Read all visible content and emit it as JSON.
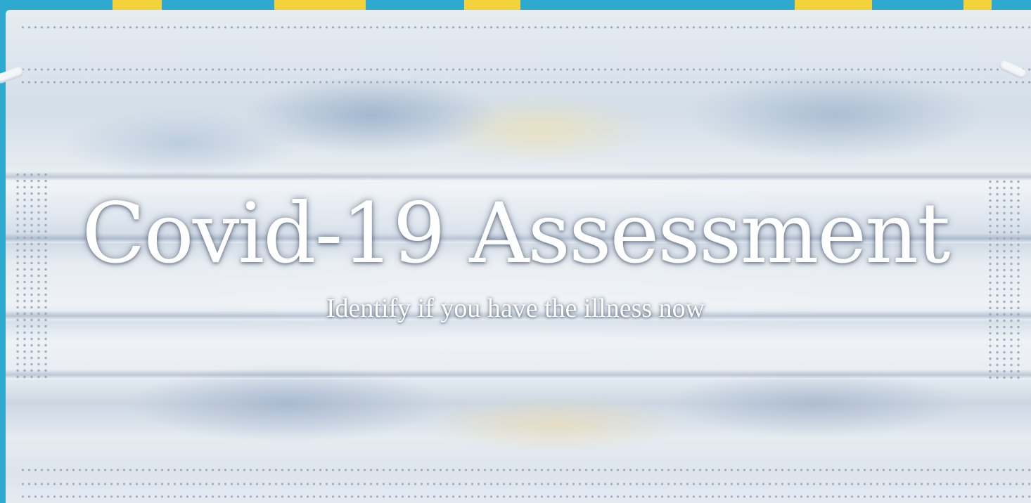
{
  "hero": {
    "title": "Covid-19 Assessment",
    "subtitle": "Identify if you have the illness now",
    "background_image": "surgical-mask-photo"
  },
  "colors": {
    "backdrop_blue": "#2ea9cf",
    "backdrop_yellow": "#f3d23a",
    "mask_base": "#e6ecf2",
    "text": "#ffffff"
  }
}
